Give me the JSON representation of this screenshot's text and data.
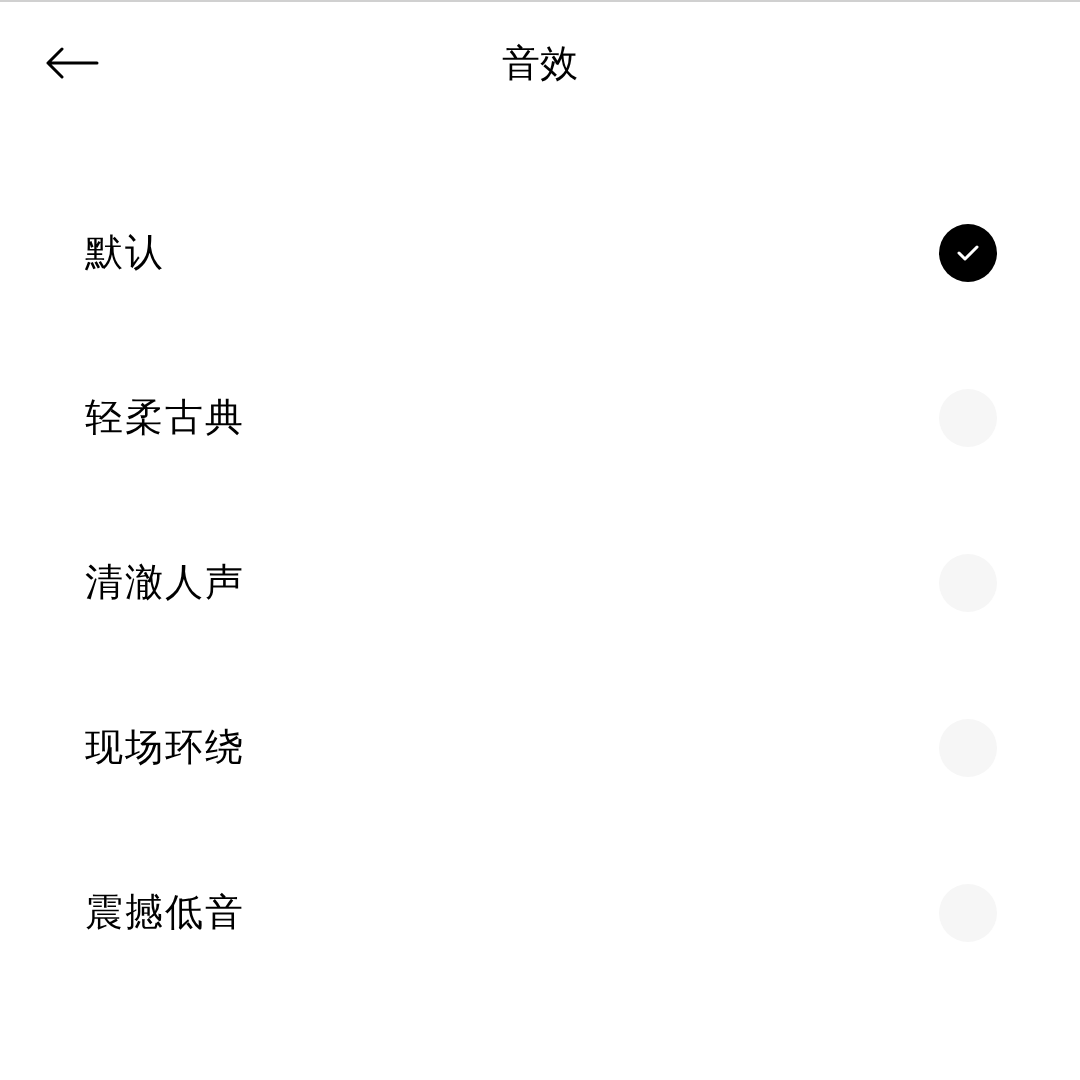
{
  "header": {
    "title": "音效"
  },
  "options": [
    {
      "label": "默认",
      "selected": true
    },
    {
      "label": "轻柔古典",
      "selected": false
    },
    {
      "label": "清澈人声",
      "selected": false
    },
    {
      "label": "现场环绕",
      "selected": false
    },
    {
      "label": "震撼低音",
      "selected": false
    }
  ]
}
